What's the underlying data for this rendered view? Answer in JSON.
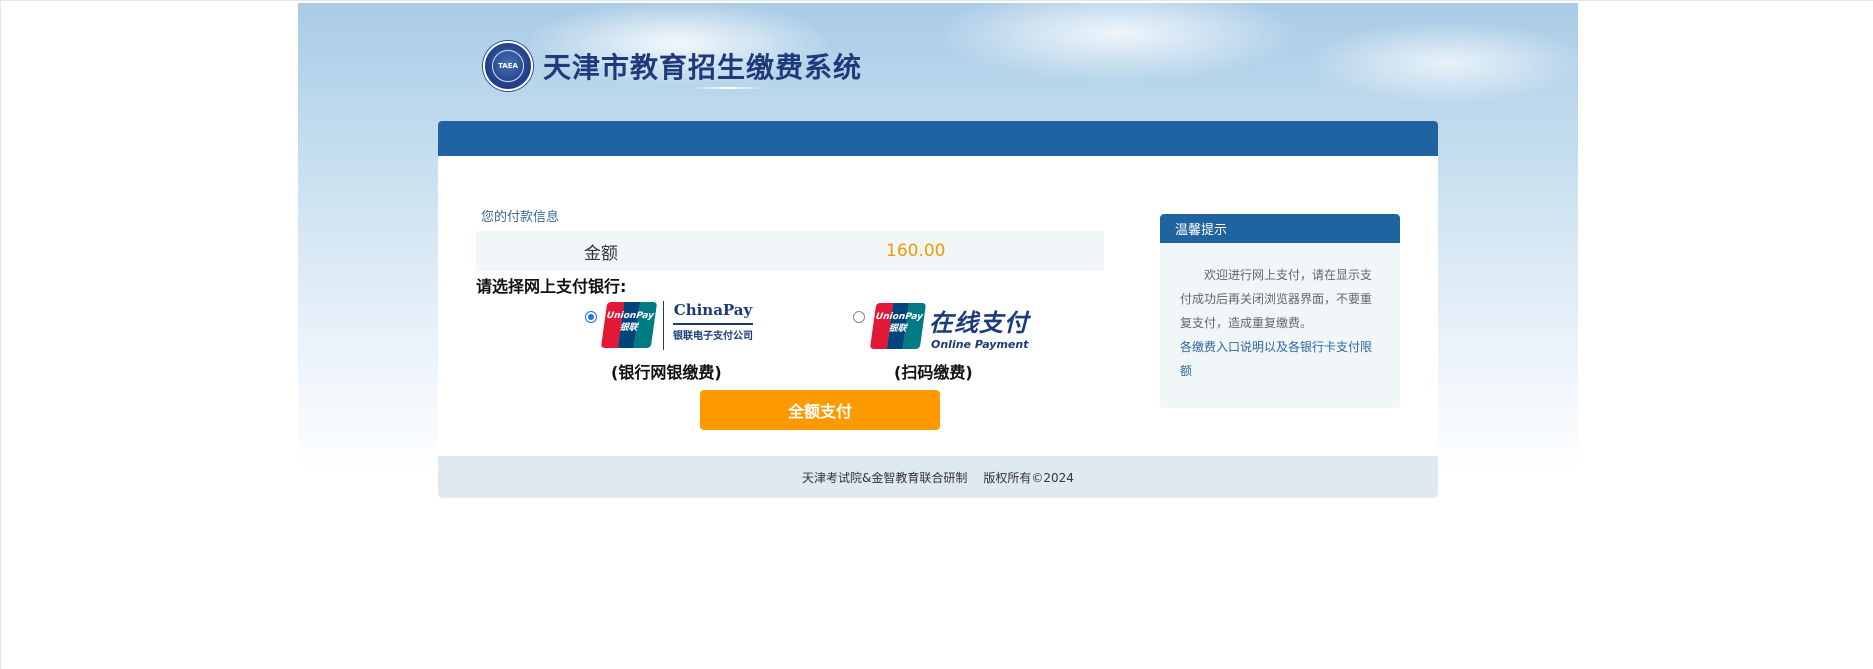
{
  "header": {
    "emblem_text": "TAEA",
    "title": "天津市教育招生缴费系统"
  },
  "payment_info": {
    "section_label": "您的付款信息",
    "amount_label": "金额",
    "amount_value": "160.00"
  },
  "bank_selection": {
    "label": "请选择网上支付银行:",
    "options": [
      {
        "logo_text": "UnionPay\n银联",
        "brand_name": "ChinaPay",
        "brand_sub": "银联电子支付公司",
        "caption": "(银行网银缴费)",
        "selected": true
      },
      {
        "logo_text": "UnionPay\n银联",
        "brand_name": "在线支付",
        "brand_sub": "Online Payment",
        "caption": "(扫码缴费)",
        "selected": false
      }
    ]
  },
  "pay_button_label": "全额支付",
  "tips": {
    "title": "温馨提示",
    "body": "欢迎进行网上支付，请在显示支付成功后再关闭浏览器界面，不要重复支付，造成重复缴费。",
    "link": "各缴费入口说明以及各银行卡支付限额"
  },
  "footer": {
    "credit": "天津考试院&金智教育联合研制",
    "copyright": "版权所有©2024"
  },
  "colors": {
    "primary": "#1f63a0",
    "accent": "#ff9900",
    "amount": "#f39800",
    "unionpay_red": "#e21836",
    "unionpay_blue": "#00447c",
    "unionpay_green": "#007b84"
  }
}
